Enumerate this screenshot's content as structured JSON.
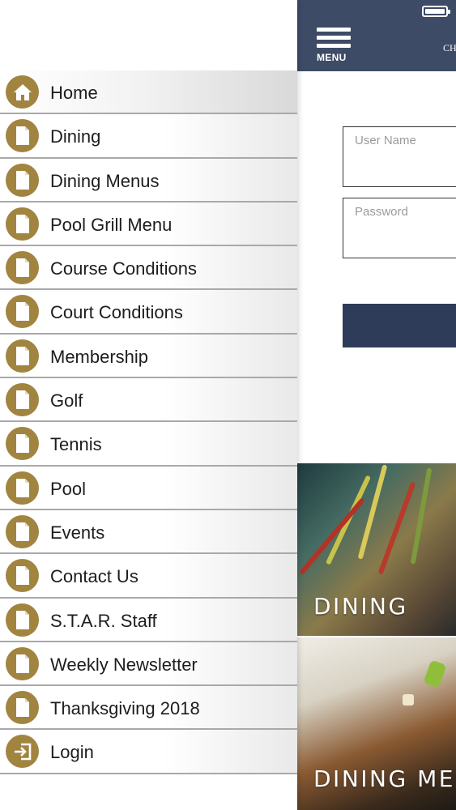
{
  "header": {
    "menu_label": "MENU",
    "club_title": "CH"
  },
  "login": {
    "username_placeholder": "User Name",
    "password_placeholder": "Password"
  },
  "tiles": [
    {
      "label": "DINING"
    },
    {
      "label": "DINING ME"
    }
  ],
  "drawer": {
    "items": [
      {
        "label": "Home",
        "icon": "home-icon",
        "active": true
      },
      {
        "label": "Dining",
        "icon": "page-icon"
      },
      {
        "label": "Dining Menus",
        "icon": "page-icon"
      },
      {
        "label": "Pool Grill Menu",
        "icon": "page-icon"
      },
      {
        "label": "Course Conditions",
        "icon": "page-icon"
      },
      {
        "label": "Court Conditions",
        "icon": "page-icon"
      },
      {
        "label": "Membership",
        "icon": "page-icon"
      },
      {
        "label": "Golf",
        "icon": "page-icon"
      },
      {
        "label": "Tennis",
        "icon": "page-icon"
      },
      {
        "label": "Pool",
        "icon": "page-icon"
      },
      {
        "label": "Events",
        "icon": "page-icon"
      },
      {
        "label": "Contact Us",
        "icon": "page-icon"
      },
      {
        "label": "S.T.A.R. Staff",
        "icon": "page-icon"
      },
      {
        "label": "Weekly Newsletter",
        "icon": "page-icon"
      },
      {
        "label": "Thanksgiving 2018",
        "icon": "page-icon"
      },
      {
        "label": "Login",
        "icon": "login-icon"
      }
    ]
  },
  "colors": {
    "header_bg": "#3d4b66",
    "icon_gold": "#a1843f",
    "button_navy": "#2e3c5a"
  }
}
